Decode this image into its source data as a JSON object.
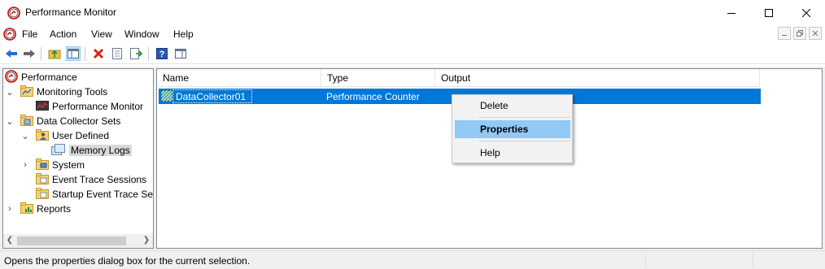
{
  "window": {
    "title": "Performance Monitor",
    "icon": "performance-monitor-app-icon"
  },
  "menu": {
    "items": [
      "File",
      "Action",
      "View",
      "Window",
      "Help"
    ]
  },
  "toolbar": {
    "buttons": [
      "back-arrow-icon",
      "forward-arrow-icon",
      "up-folder-icon",
      "show-hide-tree-icon",
      "delete-icon",
      "properties-icon",
      "export-list-icon",
      "help-icon",
      "show-hide-action-pane-icon"
    ]
  },
  "tree": {
    "root": "Performance",
    "monitoring_tools": "Monitoring Tools",
    "performance_monitor": "Performance Monitor",
    "data_collector_sets": "Data Collector Sets",
    "user_defined": "User Defined",
    "memory_logs": "Memory Logs",
    "system": "System",
    "event_trace_sessions": "Event Trace Sessions",
    "startup_event_trace": "Startup Event Trace Ses",
    "reports": "Reports"
  },
  "list": {
    "columns": [
      "Name",
      "Type",
      "Output"
    ],
    "rows": [
      {
        "name": "DataCollector01",
        "type": "Performance Counter",
        "output": ""
      }
    ]
  },
  "context_menu": {
    "delete": "Delete",
    "properties": "Properties",
    "help": "Help"
  },
  "status": {
    "text": "Opens the properties dialog box for the current selection."
  },
  "colors": {
    "selection_blue": "#0078d7",
    "menu_highlight": "#91c9f7"
  }
}
